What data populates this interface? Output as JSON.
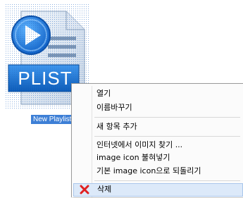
{
  "file": {
    "icon_name": "playlist-file-icon",
    "icon_text": "PLIST",
    "name": "New Playlist"
  },
  "context_menu": {
    "items": [
      {
        "label": "열기"
      },
      {
        "label": "이름바꾸기"
      },
      {
        "label": "새 항목 추가"
      },
      {
        "label": "인터넷에서 이미지 찾기 ..."
      },
      {
        "label": "image icon 불혀넣기"
      },
      {
        "label": "기본 image icon으로 되돌리기"
      },
      {
        "label": "삭제",
        "icon": "delete-x-icon",
        "highlighted": true
      }
    ]
  },
  "colors": {
    "selection": "#3d7fd6",
    "menu_highlight": "#dce9f9",
    "delete_icon": "#e02020",
    "icon_blue": "#1a6fd0"
  }
}
